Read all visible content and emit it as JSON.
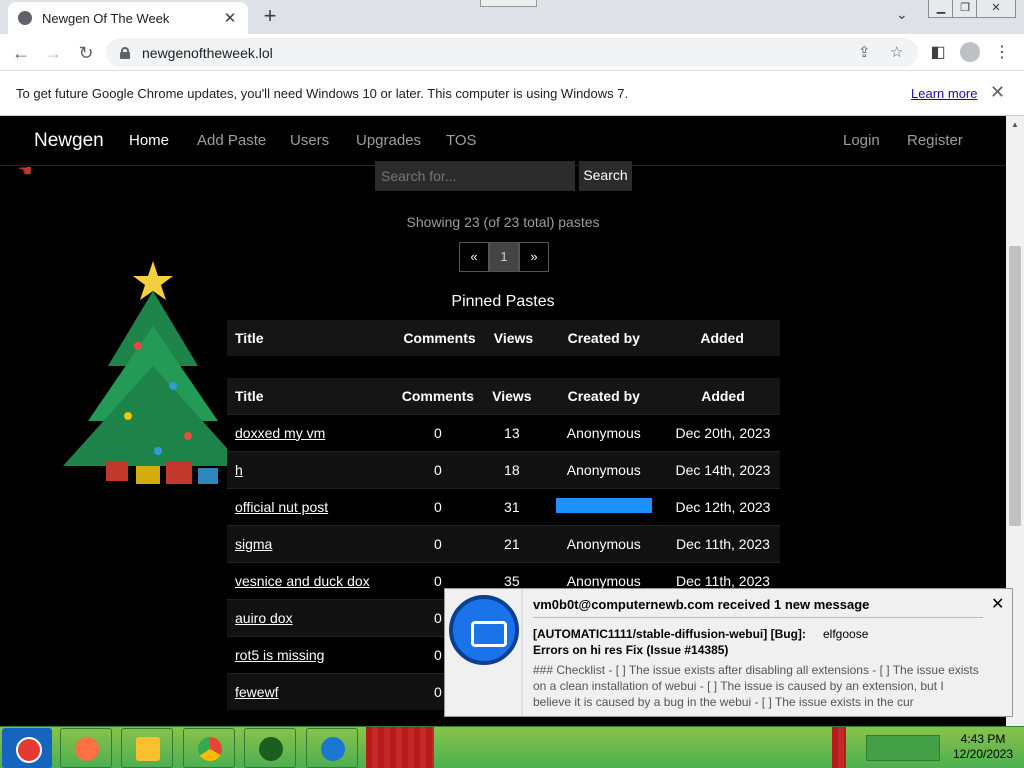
{
  "browser": {
    "tab_title": "Newgen Of The Week",
    "url": "newgenoftheweek.lol",
    "new_tab_symbol": "+",
    "tab_close_symbol": "✕"
  },
  "infobar": {
    "message": "To get future Google Chrome updates, you'll need Windows 10 or later. This computer is using Windows 7.",
    "link": "Learn more",
    "close": "✕"
  },
  "site": {
    "brand": "Newgen",
    "nav": [
      {
        "label": "Home",
        "active": true
      },
      {
        "label": "Add Paste"
      },
      {
        "label": "Users"
      },
      {
        "label": "Upgrades"
      },
      {
        "label": "TOS"
      }
    ],
    "nav_right": [
      {
        "label": "Login"
      },
      {
        "label": "Register"
      }
    ],
    "search_placeholder": "Search for...",
    "search_button": "Search",
    "showing_text": "Showing 23 (of 23 total) pastes",
    "pager": [
      "«",
      "1",
      "»"
    ],
    "pinned_heading": "Pinned Pastes",
    "columns": [
      "Title",
      "Comments",
      "Views",
      "Created by",
      "Added"
    ],
    "rows": [
      {
        "title": "doxxed my vm",
        "comments": "0",
        "views": "13",
        "created_by": "Anonymous",
        "added": "Dec 20th, 2023"
      },
      {
        "title": "h",
        "comments": "0",
        "views": "18",
        "created_by": "Anonymous",
        "added": "Dec 14th, 2023"
      },
      {
        "title": "official nut post",
        "comments": "0",
        "views": "31",
        "created_by": "",
        "added": "Dec 12th, 2023"
      },
      {
        "title": "sigma",
        "comments": "0",
        "views": "21",
        "created_by": "Anonymous",
        "added": "Dec 11th, 2023"
      },
      {
        "title": "vesnice and duck dox",
        "comments": "0",
        "views": "35",
        "created_by": "Anonymous",
        "added": "Dec 11th, 2023"
      },
      {
        "title": "auiro dox",
        "comments": "0",
        "views": "",
        "created_by": "",
        "added": ""
      },
      {
        "title": "rot5 is missing",
        "comments": "0",
        "views": "",
        "created_by": "",
        "added": ""
      },
      {
        "title": "fewewf",
        "comments": "0",
        "views": "",
        "created_by": "",
        "added": ""
      }
    ]
  },
  "notification": {
    "title": "vm0b0t@computernewb.com received 1 new message",
    "subject_line1": "[AUTOMATIC1111/stable-diffusion-webui] [Bug]:",
    "from": "elfgoose",
    "subject_line2": "Errors on hi res Fix (Issue #14385)",
    "body": "### Checklist - [ ] The issue exists after disabling all extensions - [ ] The issue exists on a clean installation of webui - [ ] The issue is caused by an extension, but I believe it is caused by a bug in the webui - [ ] The issue exists in the cur",
    "close": "✕"
  },
  "taskbar": {
    "time": "4:43 PM",
    "date": "12/20/2023"
  }
}
